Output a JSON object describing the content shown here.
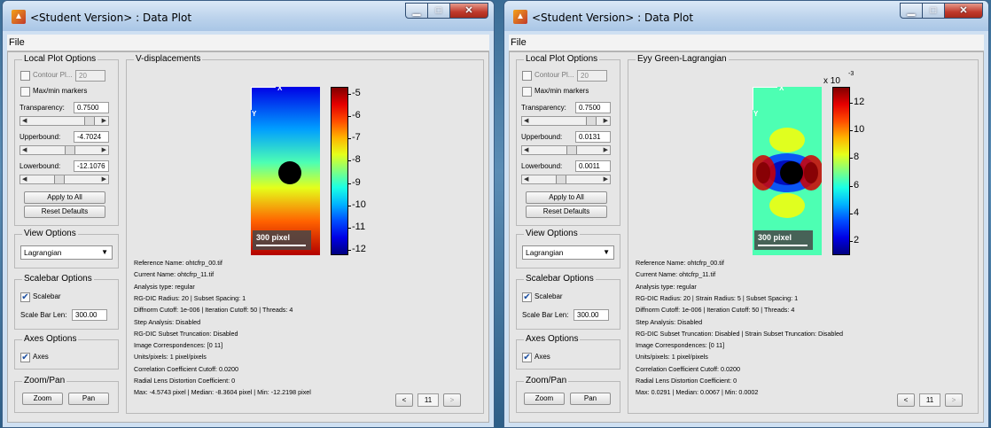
{
  "windows": [
    {
      "title": "<Student Version> : Data Plot",
      "menu": {
        "file": "File"
      },
      "local_plot_options": {
        "title": "Local Plot Options",
        "contour_label": "Contour Pl...",
        "contour_value": "20",
        "maxmin_label": "Max/min markers",
        "transparency_label": "Transparency:",
        "transparency_value": "0.7500",
        "upperbound_label": "Upperbound:",
        "upperbound_value": "-4.7024",
        "lowerbound_label": "Lowerbound:",
        "lowerbound_value": "-12.1076",
        "apply_label": "Apply to All",
        "reset_label": "Reset Defaults"
      },
      "view_options": {
        "title": "View Options",
        "selected": "Lagrangian"
      },
      "scalebar_options": {
        "title": "Scalebar Options",
        "scalebar_label": "Scalebar",
        "len_label": "Scale Bar Len:",
        "len_value": "300.00"
      },
      "axes_options": {
        "title": "Axes Options",
        "axes_label": "Axes"
      },
      "zoom_pan": {
        "title": "Zoom/Pan",
        "zoom_label": "Zoom",
        "pan_label": "Pan"
      },
      "plot": {
        "title": "V-displacements",
        "axis_x": "X",
        "axis_y": "Y",
        "scalebar_text": "300 pixel",
        "colorbar_multiplier": "",
        "colorbar_ticks": [
          "-5",
          "-6",
          "-7",
          "-8",
          "-9",
          "-10",
          "-11",
          "-12"
        ]
      },
      "info": [
        "Reference Name: ohtcfrp_00.tif",
        "Current Name: ohtcfrp_11.tif",
        "Analysis type: regular",
        "RG-DIC Radius: 20 | Subset Spacing: 1",
        "Diffnorm Cutoff: 1e-006 | Iteration Cutoff: 50 | Threads: 4",
        "Step Analysis: Disabled",
        "RG-DIC Subset Truncation: Disabled",
        "Image Correspondences: [0 11]",
        "Units/pixels: 1 pixel/pixels",
        "Correlation Coefficient Cutoff: 0.0200",
        "Radial Lens Distortion Coefficient: 0",
        "Max: -4.5743 pixel | Median: -8.3604 pixel | Min: -12.2198 pixel"
      ],
      "nav": {
        "prev": "<",
        "frame": "11",
        "next": ">"
      },
      "colors": {
        "plot_mode": "displacement"
      }
    },
    {
      "title": "<Student Version> : Data Plot",
      "menu": {
        "file": "File"
      },
      "local_plot_options": {
        "title": "Local Plot Options",
        "contour_label": "Contour Pl...",
        "contour_value": "20",
        "maxmin_label": "Max/min markers",
        "transparency_label": "Transparency:",
        "transparency_value": "0.7500",
        "upperbound_label": "Upperbound:",
        "upperbound_value": "0.0131",
        "lowerbound_label": "Lowerbound:",
        "lowerbound_value": "0.0011",
        "apply_label": "Apply to All",
        "reset_label": "Reset Defaults"
      },
      "view_options": {
        "title": "View Options",
        "selected": "Lagrangian"
      },
      "scalebar_options": {
        "title": "Scalebar Options",
        "scalebar_label": "Scalebar",
        "len_label": "Scale Bar Len:",
        "len_value": "300.00"
      },
      "axes_options": {
        "title": "Axes Options",
        "axes_label": "Axes"
      },
      "zoom_pan": {
        "title": "Zoom/Pan",
        "zoom_label": "Zoom",
        "pan_label": "Pan"
      },
      "plot": {
        "title": "Eyy Green-Lagrangian",
        "axis_x": "X",
        "axis_y": "Y",
        "scalebar_text": "300 pixel",
        "colorbar_multiplier": "x 10",
        "colorbar_exponent": "-3",
        "colorbar_ticks": [
          "12",
          "10",
          "8",
          "6",
          "4",
          "2"
        ]
      },
      "info": [
        "Reference Name: ohtcfrp_00.tif",
        "Current Name: ohtcfrp_11.tif",
        "Analysis type: regular",
        "RG-DIC Radius: 20 | Strain Radius: 5 | Subset Spacing: 1",
        "Diffnorm Cutoff: 1e-006 | Iteration Cutoff: 50 | Threads: 4",
        "Step Analysis: Disabled",
        "RG-DIC Subset Truncation: Disabled | Strain Subset Truncation: Disabled",
        "Image Correspondences: [0 11]",
        "Units/pixels: 1 pixel/pixels",
        "Correlation Coefficient Cutoff: 0.0200",
        "Radial Lens Distortion Coefficient: 0",
        "Max: 0.0291 | Median: 0.0067 | Min: 0.0002"
      ],
      "nav": {
        "prev": "<",
        "frame": "11",
        "next": ">"
      },
      "colors": {
        "plot_mode": "strain"
      }
    }
  ]
}
